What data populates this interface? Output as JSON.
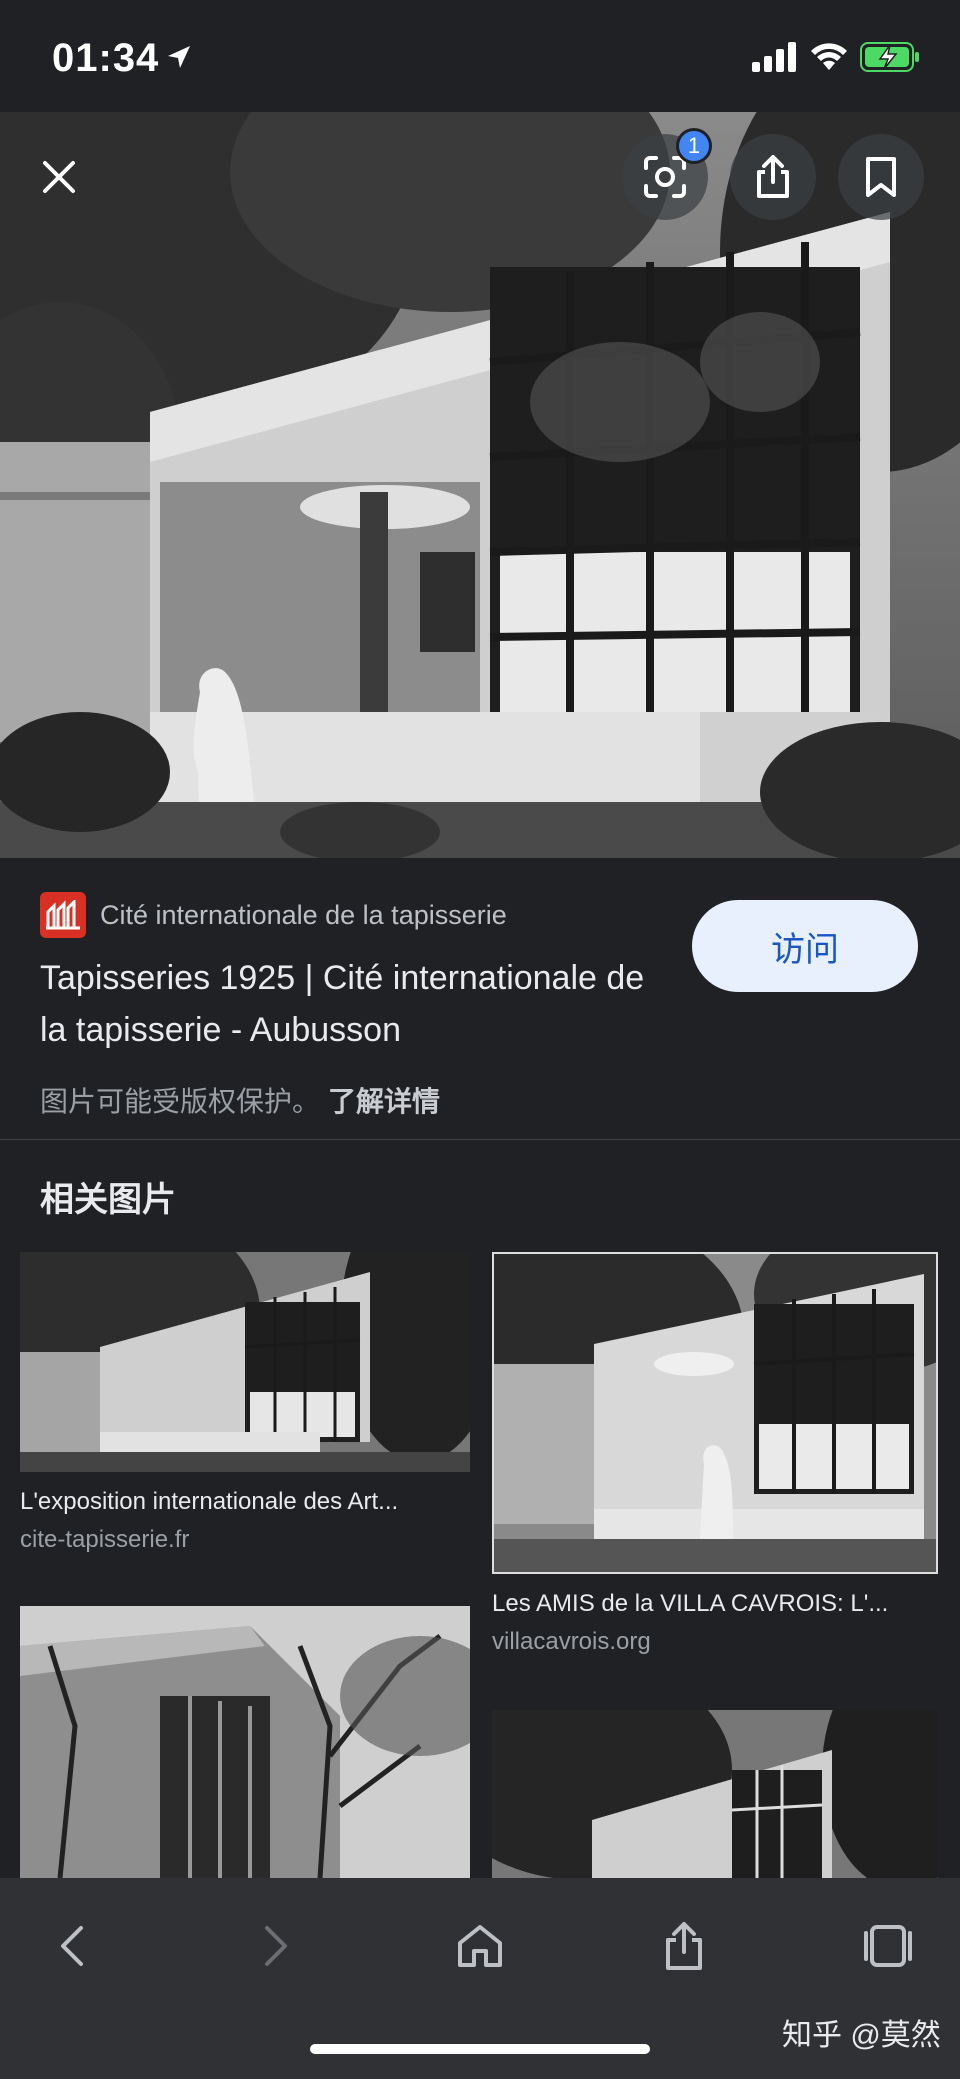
{
  "status_bar": {
    "time": "01:34"
  },
  "viewer": {
    "lens_badge_count": "1"
  },
  "source": {
    "site_name": "Cité internationale de la tapisserie",
    "title": "Tapisseries 1925 | Cité internationale de la tapisserie - Aubusson",
    "visit_label": "访问",
    "copyright_text": "图片可能受版权保护。",
    "learn_more_label": "了解详情"
  },
  "related": {
    "heading": "相关图片",
    "items": [
      {
        "title": "L'exposition internationale des Art...",
        "domain": "cite-tapisserie.fr"
      },
      {
        "title": "Les AMIS de la VILLA CAVROIS: L'...",
        "domain": "villacavrois.org"
      }
    ]
  },
  "watermark": "知乎 @莫然",
  "colors": {
    "background": "#202124",
    "toolbar": "#303134",
    "visit_button": "#e8f0fe",
    "visit_text": "#1a56c4",
    "badge": "#4285f4",
    "source_logo": "#d93025"
  }
}
